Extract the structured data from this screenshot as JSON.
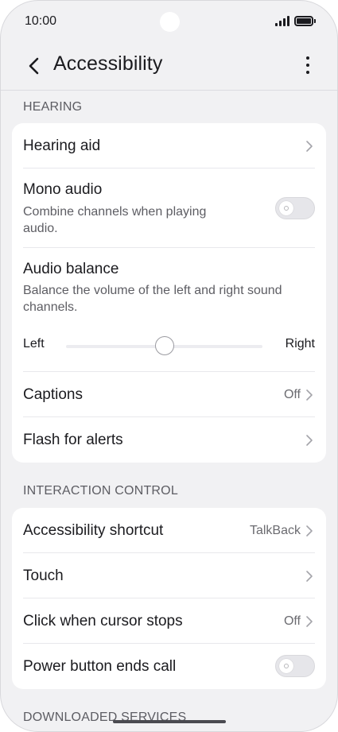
{
  "status_bar": {
    "time": "10:00",
    "icons": [
      "signal-icon",
      "battery-icon"
    ]
  },
  "app_bar": {
    "title": "Accessibility",
    "back_icon": "chevron-left-icon",
    "menu_icon": "more-vertical-icon"
  },
  "hearing": {
    "header": "HEARING",
    "hearing_aid": {
      "label": "Hearing aid"
    },
    "mono_audio": {
      "label": "Mono audio",
      "description_line1": "Combine channels when playing",
      "description_line2": "audio.",
      "enabled": false
    },
    "audio_balance": {
      "label": "Audio balance",
      "description_line1": "Balance the volume of the left and right sound",
      "description_line2": "channels.",
      "left_label": "Left",
      "right_label": "Right",
      "position_fraction": 0.5
    },
    "captions": {
      "label": "Captions",
      "value": "Off"
    },
    "flash_for_alerts": {
      "label": "Flash for alerts"
    }
  },
  "interaction_control": {
    "header": "INTERACTION CONTROL",
    "accessibility_shortcut": {
      "label": "Accessibility shortcut",
      "value": "TalkBack"
    },
    "touch": {
      "label": "Touch"
    },
    "click_when_cursor_stops": {
      "label": "Click when cursor stops",
      "value": "Off"
    },
    "power_button_ends_call": {
      "label": "Power button ends call",
      "enabled": false
    }
  },
  "downloaded_services": {
    "header": "DOWNLOADED SERVICES"
  },
  "colors": {
    "background": "#f1f1f3",
    "card": "#ffffff",
    "text_primary": "#1b1b1f",
    "text_secondary": "#5d5d63",
    "toggle_off": "#e6e6ea"
  }
}
